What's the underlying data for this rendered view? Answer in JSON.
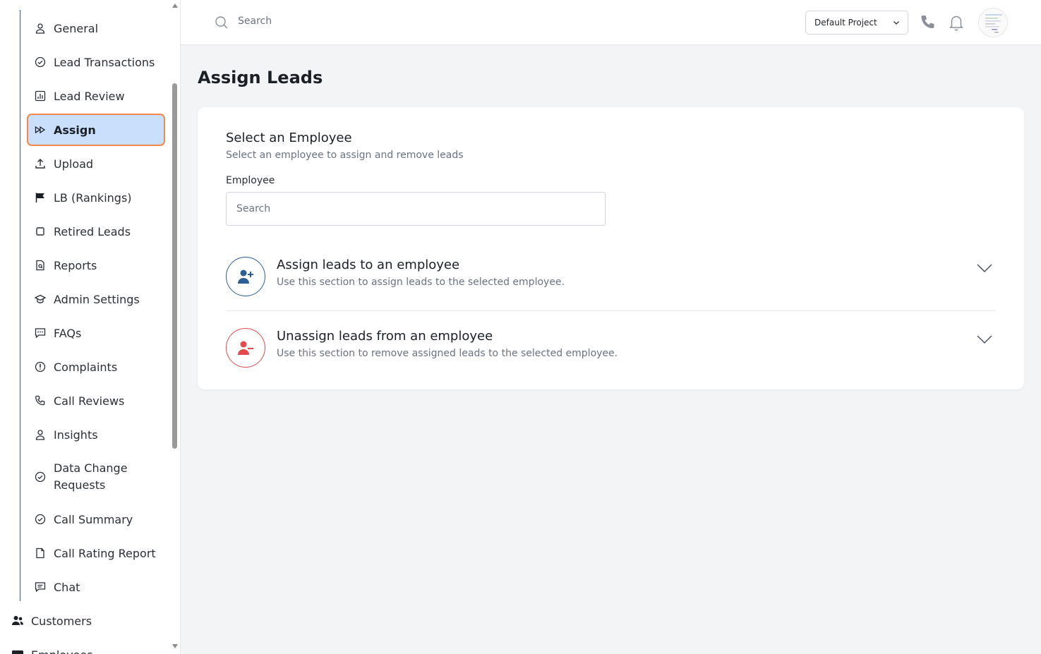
{
  "sidebar": {
    "items": [
      {
        "label": "General",
        "icon": "user-icon"
      },
      {
        "label": "Lead Transactions",
        "icon": "check-circle-icon"
      },
      {
        "label": "Lead Review",
        "icon": "bar-chart-icon"
      },
      {
        "label": "Assign",
        "icon": "fast-forward-icon",
        "active": true
      },
      {
        "label": "Upload",
        "icon": "upload-icon"
      },
      {
        "label": "LB (Rankings)",
        "icon": "flag-icon"
      },
      {
        "label": "Retired Leads",
        "icon": "square-icon"
      },
      {
        "label": "Reports",
        "icon": "report-file-icon"
      },
      {
        "label": "Admin Settings",
        "icon": "graduation-cap-icon"
      },
      {
        "label": "FAQs",
        "icon": "chat-bubble-icon"
      },
      {
        "label": "Complaints",
        "icon": "alert-circle-icon"
      },
      {
        "label": "Call Reviews",
        "icon": "phone-icon"
      },
      {
        "label": "Insights",
        "icon": "user-icon"
      },
      {
        "label": "Data Change Requests",
        "icon": "check-circle-icon"
      },
      {
        "label": "Call Summary",
        "icon": "check-circle-icon"
      },
      {
        "label": "Call Rating Report",
        "icon": "file-icon"
      },
      {
        "label": "Chat",
        "icon": "message-icon"
      }
    ],
    "top_items": [
      {
        "label": "Customers",
        "icon": "users-icon"
      },
      {
        "label": "Employees",
        "icon": "id-card-icon"
      }
    ]
  },
  "topbar": {
    "search_placeholder": "Search",
    "project": "Default Project"
  },
  "main": {
    "title": "Assign Leads",
    "card": {
      "title": "Select an Employee",
      "subtitle": "Select an employee to assign and remove leads",
      "field_label": "Employee",
      "field_placeholder": "Search",
      "sections": [
        {
          "title": "Assign leads to an employee",
          "desc": "Use this section to assign leads to the selected employee.",
          "color": "#2a5f97"
        },
        {
          "title": "Unassign leads from an employee",
          "desc": "Use this section to remove assigned leads to the selected employee.",
          "color": "#e5484d"
        }
      ]
    }
  },
  "colors": {
    "active_bg": "#c9dffb",
    "active_border": "#f08a4b",
    "accent_blue": "#2a5f97",
    "accent_red": "#e5484d"
  }
}
